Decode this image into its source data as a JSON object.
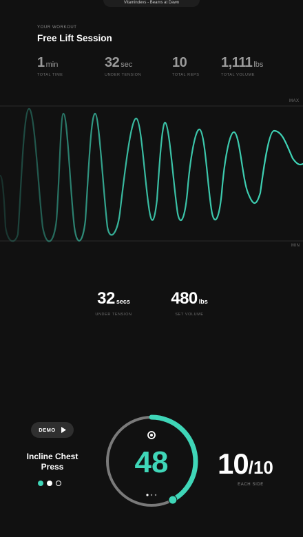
{
  "now_playing": "Vitamindevs - Beams at Dawn",
  "workout": {
    "eyebrow": "YOUR WORKOUT",
    "title": "Free Lift Session",
    "stats": [
      {
        "value": "1",
        "unit": "min",
        "label": "TOTAL TIME"
      },
      {
        "value": "32",
        "unit": "sec",
        "label": "UNDER TENSION"
      },
      {
        "value": "10",
        "unit": "",
        "label": "TOTAL REPS"
      },
      {
        "value": "1,111",
        "unit": "lbs",
        "label": "TOTAL VOLUME"
      }
    ]
  },
  "chart": {
    "max_label": "MAX",
    "min_label": "MIN",
    "accent": "#3fd6b8"
  },
  "set": {
    "tension_value": "32",
    "tension_unit": "secs",
    "tension_label": "UNDER TENSION",
    "volume_value": "480",
    "volume_unit": "lbs",
    "volume_label": "SET VOLUME"
  },
  "exercise": {
    "demo_label": "DEMO",
    "name": "Incline Chest Press",
    "sets_total": 3,
    "sets_completed": 2,
    "current_value": "48",
    "ring_progress": 0.42,
    "reps_done": "10",
    "reps_total": "/10",
    "mode_label": "EACH SIDE"
  },
  "colors": {
    "accent": "#3fd6b8",
    "background": "#111111",
    "muted": "#6f6f6f"
  }
}
